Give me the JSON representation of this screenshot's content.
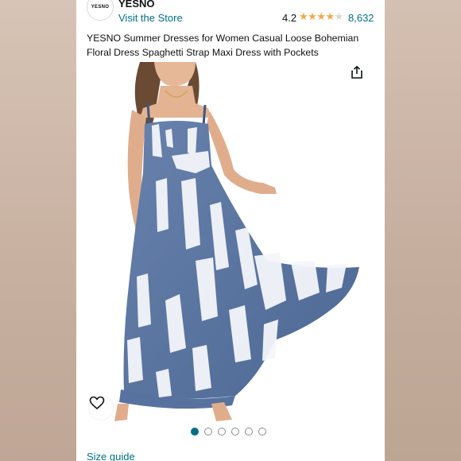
{
  "store": {
    "logo_text": "YESNO",
    "brand_name": "YESNO",
    "visit_link": "Visit the Store"
  },
  "rating": {
    "value": "4.2",
    "stars_full": 4,
    "stars_total": 5,
    "count": "8,632"
  },
  "product": {
    "title": "YESNO Summer Dresses for Women Casual Loose Bohemian Floral Dress Spaghetti Strap Maxi Dress with Pockets",
    "image_icon": "product-photo-dress"
  },
  "gallery": {
    "total_images": 6,
    "active_index": 0
  },
  "actions": {
    "share_icon": "share-icon",
    "wishlist_icon": "heart-icon"
  },
  "links": {
    "size_guide": "Size guide"
  },
  "colors": {
    "link": "#007185",
    "star": "#f3a847",
    "dress": "#5a76a3"
  }
}
